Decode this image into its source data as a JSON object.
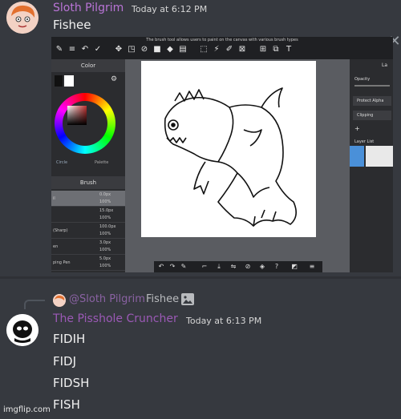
{
  "message1": {
    "username": "Sloth Pilgrim",
    "timestamp": "Today at 6:12 PM",
    "text": "Fishee",
    "close_glyph": "✕",
    "username_color": "#b974d6"
  },
  "app_screenshot": {
    "caption": "The brush tool allows users to paint on the canvas with various brush types",
    "left_panel": {
      "color_header": "Color",
      "tab_circle": "Circle",
      "tab_palette": "Palette",
      "brush_header": "Brush",
      "brushes": [
        {
          "name": "il",
          "size": "0.0px",
          "opacity": "100%"
        },
        {
          "name": "",
          "size": "15.0px",
          "opacity": "100%"
        },
        {
          "name": "(Sharp)",
          "size": "100.0px",
          "opacity": "100%"
        },
        {
          "name": "en",
          "size": "3.0px",
          "opacity": "100%"
        },
        {
          "name": "ping Pen",
          "size": "5.0px",
          "opacity": "100%"
        }
      ]
    },
    "right_panel": {
      "title": "La",
      "opacity_label": "Opacity",
      "protect_alpha": "Protect Alpha",
      "clipping": "Clipping",
      "layer_list": "Layer List"
    }
  },
  "message2": {
    "reply_username": "@Sloth Pilgrim",
    "reply_text": "Fishee",
    "username": "The Pisshole Cruncher",
    "timestamp": "Today at 6:13 PM",
    "lines": [
      "FIDIH",
      "FIDJ",
      "FIDSH",
      "FISH"
    ],
    "username_color": "#9b59b6"
  },
  "watermark": "imgflip.com"
}
